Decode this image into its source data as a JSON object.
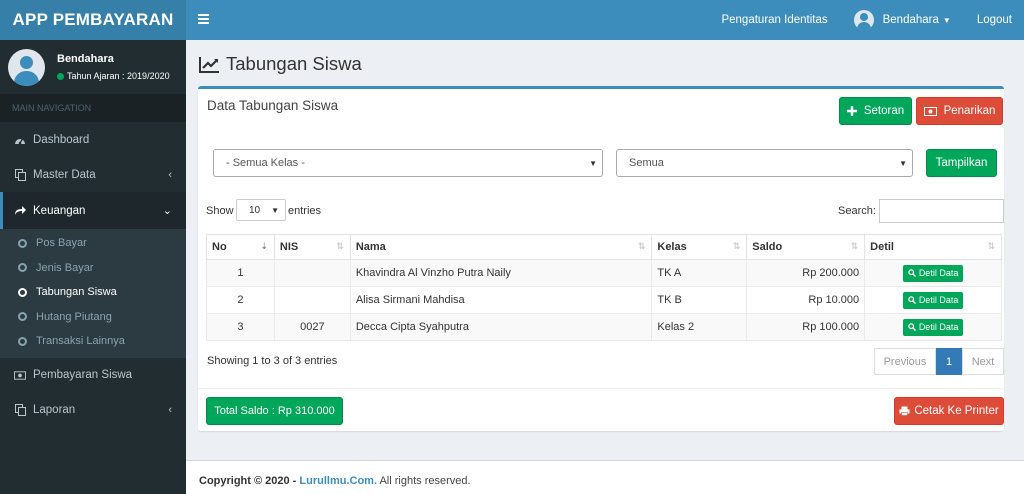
{
  "app": {
    "logo": "APP PEMBAYARAN"
  },
  "user": {
    "name": "Bendahara",
    "status": "Tahun Ajaran : 2019/2020"
  },
  "sidebar": {
    "header": "MAIN NAVIGATION",
    "items": [
      {
        "label": "Dashboard",
        "icon": "dashboard-icon"
      },
      {
        "label": "Master Data",
        "icon": "copy-icon"
      },
      {
        "label": "Keuangan",
        "icon": "share-icon"
      },
      {
        "label": "Pembayaran Siswa",
        "icon": "money-icon"
      },
      {
        "label": "Laporan",
        "icon": "copy-icon"
      }
    ],
    "submenu": [
      "Pos Bayar",
      "Jenis Bayar",
      "Tabungan Siswa",
      "Hutang Piutang",
      "Transaksi Lainnya"
    ]
  },
  "topbar": {
    "identity": "Pengaturan Identitas",
    "user": "Bendahara",
    "logout": "Logout"
  },
  "page": {
    "title": "Tabungan Siswa"
  },
  "box": {
    "title": "Data Tabungan Siswa",
    "btn_setoran": "Setoran",
    "btn_penarikan": "Penarikan",
    "filter_kelas": "- Semua Kelas -",
    "filter_status": "Semua",
    "btn_tampilkan": "Tampilkan",
    "show_label": "Show",
    "show_value": "10",
    "entries_label": "entries",
    "search_label": "Search:",
    "showing": "Showing 1 to 3 of 3 entries",
    "pager": {
      "prev": "Previous",
      "page": "1",
      "next": "Next"
    },
    "total": "Total Saldo : Rp 310.000",
    "cetak": "Cetak Ke Printer"
  },
  "table": {
    "headers": [
      "No",
      "NIS",
      "Nama",
      "Kelas",
      "Saldo",
      "Detil"
    ],
    "rows": [
      {
        "no": "1",
        "nis": "",
        "nama": "Khavindra Al Vinzho Putra Naily",
        "kelas": "TK A",
        "saldo": "Rp 200.000",
        "detil": "Detil Data"
      },
      {
        "no": "2",
        "nis": "",
        "nama": "Alisa Sirmani Mahdisa",
        "kelas": "TK B",
        "saldo": "Rp 10.000",
        "detil": "Detil Data"
      },
      {
        "no": "3",
        "nis": "0027",
        "nama": "Decca Cipta Syahputra",
        "kelas": "Kelas 2",
        "saldo": "Rp 100.000",
        "detil": "Detil Data"
      }
    ]
  },
  "footer": {
    "prefix": "Copyright © 2020 - ",
    "link": "Lurullmu.Com.",
    "suffix": " All rights reserved."
  },
  "colors": {
    "primary": "#3c8dbc",
    "sidebar": "#222d32",
    "success": "#00a65a",
    "danger": "#dd4b39"
  }
}
